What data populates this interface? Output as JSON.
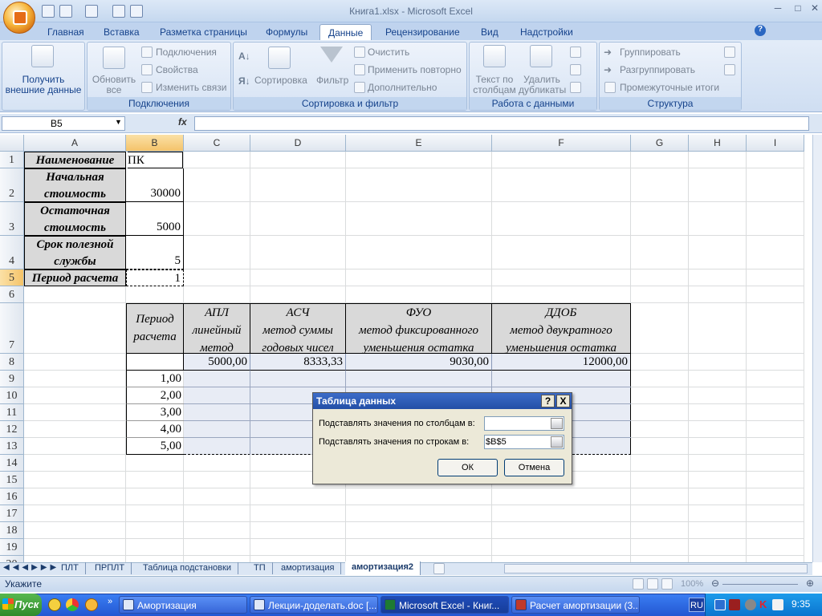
{
  "window": {
    "title": "Книга1.xlsx - Microsoft Excel"
  },
  "ribbon_tabs": [
    "Главная",
    "Вставка",
    "Разметка страницы",
    "Формулы",
    "Данные",
    "Рецензирование",
    "Вид",
    "Надстройки"
  ],
  "ribbon": {
    "get_external": "Получить\nвнешние данные",
    "refresh_all": "Обновить\nвсе",
    "connections": "Подключения",
    "properties": "Свойства",
    "edit_links": "Изменить связи",
    "group_connections": "Подключения",
    "sort": "Сортировка",
    "filter": "Фильтр",
    "clear": "Очистить",
    "reapply": "Применить повторно",
    "advanced": "Дополнительно",
    "group_sort": "Сортировка и фильтр",
    "text_to_columns": "Текст по\nстолбцам",
    "remove_duplicates": "Удалить\nдубликаты",
    "group_data": "Работа с данными",
    "group_btn": "Группировать",
    "ungroup_btn": "Разгруппировать",
    "subtotals": "Промежуточные итоги",
    "group_outline": "Структура"
  },
  "formula_bar": {
    "name_box": "B5",
    "fx": "fx",
    "formula": ""
  },
  "columns": [
    "A",
    "B",
    "C",
    "D",
    "E",
    "F",
    "G",
    "H",
    "I"
  ],
  "rows": [
    "1",
    "2",
    "3",
    "4",
    "5",
    "6",
    "7",
    "8",
    "9",
    "10",
    "11",
    "12",
    "13",
    "14",
    "15",
    "16",
    "17",
    "18",
    "19",
    "20"
  ],
  "cells": {
    "a1": "Наименование",
    "b1": "ПК",
    "a2": "Начальная\nстоимость",
    "b2": "30000",
    "a3": "Остаточная\nстоимость",
    "b3": "5000",
    "a4": "Срок полезной\nслужбы",
    "b4": "5",
    "a5": "Период расчета",
    "b5": "1",
    "b7": "Период\nрасчета",
    "c7": "АПЛ\nлинейный\nметод",
    "d7": "АСЧ\nметод суммы\nгодовых чисел",
    "e7": "ФУО\nметод фиксированного\nуменьшения остатка",
    "f7": "ДДОБ\nметод двукратного\nуменьшения остатка",
    "c8": "5000,00",
    "d8": "8333,33",
    "e8": "9030,00",
    "f8": "12000,00",
    "b9": "1,00",
    "b10": "2,00",
    "b11": "3,00",
    "b12": "4,00",
    "b13": "5,00"
  },
  "dialog": {
    "title": "Таблица данных",
    "help": "?",
    "close": "X",
    "col_label": "Подставлять значения по столбцам в:",
    "col_value": "",
    "row_label": "Подставлять значения по строкам в:",
    "row_value": "$B$5",
    "ok": "ОК",
    "cancel": "Отмена"
  },
  "sheet_tabs": [
    "ПЛТ",
    "ПРПЛТ",
    "Таблица подстановки",
    "ТП",
    "амортизация",
    "амортизация2"
  ],
  "active_sheet": "амортизация2",
  "status": {
    "mode": "Укажите",
    "zoom": "100%"
  },
  "taskbar": {
    "start": "Пуск",
    "tasks": [
      "Амортизация",
      "Лекции-доделать.doc [...",
      "Microsoft Excel - Книг...",
      "Расчет амортизации (3..."
    ],
    "lang": "RU",
    "clock": "9:35"
  }
}
